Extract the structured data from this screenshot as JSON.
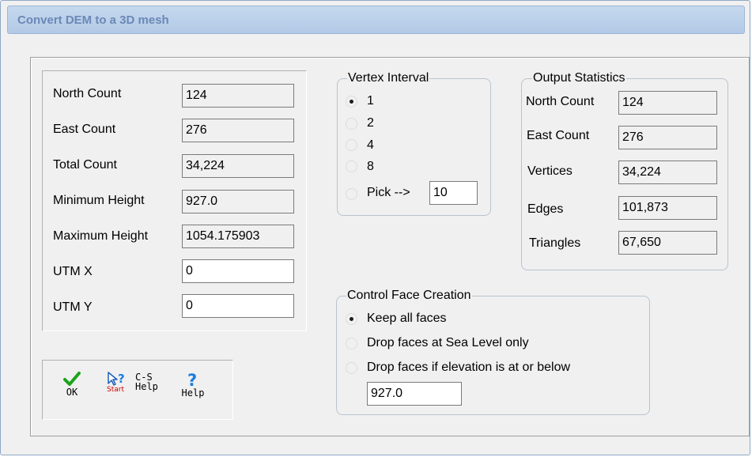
{
  "window": {
    "title": "Convert DEM to a 3D mesh"
  },
  "input": {
    "north_count": {
      "label": "North Count",
      "value": "124"
    },
    "east_count": {
      "label": "East Count",
      "value": "276"
    },
    "total_count": {
      "label": "Total Count",
      "value": "34,224"
    },
    "min_height": {
      "label": "Minimum Height",
      "value": "927.0"
    },
    "max_height": {
      "label": "Maximum Height",
      "value": "1054.175903"
    },
    "utm_x": {
      "label": "UTM X",
      "value": "0"
    },
    "utm_y": {
      "label": "UTM Y",
      "value": "0"
    }
  },
  "vertex_interval": {
    "title": "Vertex Interval",
    "options": [
      "1",
      "2",
      "4",
      "8",
      "Pick -->"
    ],
    "selected": "1",
    "pick_value": "10"
  },
  "output_stats": {
    "title": "Output Statistics",
    "north_count": {
      "label": "North Count",
      "value": "124"
    },
    "east_count": {
      "label": "East Count",
      "value": "276"
    },
    "vertices": {
      "label": "Vertices",
      "value": "34,224"
    },
    "edges": {
      "label": "Edges",
      "value": "101,873"
    },
    "triangles": {
      "label": "Triangles",
      "value": "67,650"
    }
  },
  "face_creation": {
    "title": "Control Face Creation",
    "options": [
      "Keep all faces",
      "Drop faces at Sea Level only",
      "Drop faces if elevation is at or below"
    ],
    "selected": "Keep all faces",
    "elevation_value": "927.0"
  },
  "toolbar": {
    "ok": {
      "label": "OK",
      "icon": "checkmark-icon",
      "color": "#1aa31a"
    },
    "cs_help": {
      "label_top": "C-S",
      "label_bottom": "Help",
      "icon_text": "Start",
      "icon": "pointer-question-icon",
      "icon_text_color": "#cc0000"
    },
    "help": {
      "label": "Help",
      "icon": "question-mark-icon",
      "color": "#1c7ee0"
    }
  }
}
